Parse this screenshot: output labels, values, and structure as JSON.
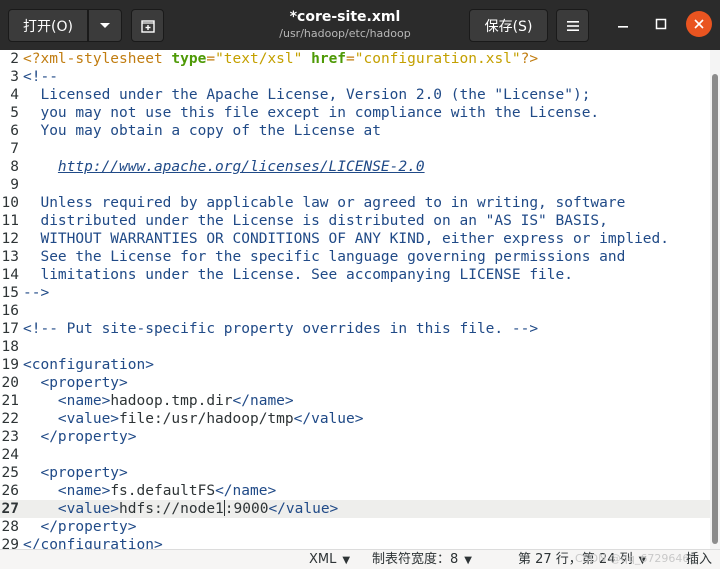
{
  "header": {
    "open_label": "打开(O)",
    "title": "*core-site.xml",
    "path": "/usr/hadoop/etc/hadoop",
    "save_label": "保存(S)"
  },
  "editor": {
    "current_line": 27,
    "lines": [
      {
        "n": "2",
        "segs": [
          [
            "pi",
            "<?xml-stylesheet "
          ],
          [
            "attr",
            "type"
          ],
          [
            "pi",
            "="
          ],
          [
            "str",
            "\"text/xsl\""
          ],
          [
            "pi",
            " "
          ],
          [
            "attr",
            "href"
          ],
          [
            "pi",
            "="
          ],
          [
            "str",
            "\"configuration.xsl\""
          ],
          [
            "pi",
            "?>"
          ]
        ]
      },
      {
        "n": "3",
        "segs": [
          [
            "comment",
            "<!--"
          ]
        ]
      },
      {
        "n": "4",
        "segs": [
          [
            "comment",
            "  Licensed under the Apache License, Version 2.0 (the \"License\");"
          ]
        ]
      },
      {
        "n": "5",
        "segs": [
          [
            "comment",
            "  you may not use this file except in compliance with the License."
          ]
        ]
      },
      {
        "n": "6",
        "segs": [
          [
            "comment",
            "  You may obtain a copy of the License at"
          ]
        ]
      },
      {
        "n": "7",
        "segs": []
      },
      {
        "n": "8",
        "segs": [
          [
            "comment",
            "    "
          ],
          [
            "link",
            "http://www.apache.org/licenses/LICENSE-2.0"
          ]
        ]
      },
      {
        "n": "9",
        "segs": []
      },
      {
        "n": "10",
        "segs": [
          [
            "comment",
            "  Unless required by applicable law or agreed to in writing, software"
          ]
        ]
      },
      {
        "n": "11",
        "segs": [
          [
            "comment",
            "  distributed under the License is distributed on an \"AS IS\" BASIS,"
          ]
        ]
      },
      {
        "n": "12",
        "segs": [
          [
            "comment",
            "  WITHOUT WARRANTIES OR CONDITIONS OF ANY KIND, either express or implied."
          ]
        ]
      },
      {
        "n": "13",
        "segs": [
          [
            "comment",
            "  See the License for the specific language governing permissions and"
          ]
        ]
      },
      {
        "n": "14",
        "segs": [
          [
            "comment",
            "  limitations under the License. See accompanying LICENSE file."
          ]
        ]
      },
      {
        "n": "15",
        "segs": [
          [
            "comment",
            "-->"
          ]
        ]
      },
      {
        "n": "16",
        "segs": []
      },
      {
        "n": "17",
        "segs": [
          [
            "comment",
            "<!-- Put site-specific property overrides in this file. -->"
          ]
        ]
      },
      {
        "n": "18",
        "segs": []
      },
      {
        "n": "19",
        "segs": [
          [
            "tag",
            "<configuration>"
          ]
        ]
      },
      {
        "n": "20",
        "segs": [
          [
            "text",
            "  "
          ],
          [
            "tag",
            "<property>"
          ]
        ]
      },
      {
        "n": "21",
        "segs": [
          [
            "text",
            "    "
          ],
          [
            "tag",
            "<name>"
          ],
          [
            "text",
            "hadoop.tmp.dir"
          ],
          [
            "tag",
            "</name>"
          ]
        ]
      },
      {
        "n": "22",
        "segs": [
          [
            "text",
            "    "
          ],
          [
            "tag",
            "<value>"
          ],
          [
            "text",
            "file:/usr/hadoop/tmp"
          ],
          [
            "tag",
            "</value>"
          ]
        ]
      },
      {
        "n": "23",
        "segs": [
          [
            "text",
            "  "
          ],
          [
            "tag",
            "</property>"
          ]
        ]
      },
      {
        "n": "24",
        "segs": []
      },
      {
        "n": "25",
        "segs": [
          [
            "text",
            "  "
          ],
          [
            "tag",
            "<property>"
          ]
        ]
      },
      {
        "n": "26",
        "segs": [
          [
            "text",
            "    "
          ],
          [
            "tag",
            "<name>"
          ],
          [
            "text",
            "fs.defaultFS"
          ],
          [
            "tag",
            "</name>"
          ]
        ]
      },
      {
        "n": "27",
        "segs": [
          [
            "text",
            "    "
          ],
          [
            "tag",
            "<value>"
          ],
          [
            "text",
            "hdfs://node1"
          ],
          [
            "cursor",
            ""
          ],
          [
            "text",
            ":9000"
          ],
          [
            "tag",
            "</value>"
          ]
        ]
      },
      {
        "n": "28",
        "segs": [
          [
            "text",
            "  "
          ],
          [
            "tag",
            "</property>"
          ]
        ]
      },
      {
        "n": "29",
        "segs": [
          [
            "tag",
            "</configuration>"
          ]
        ]
      }
    ]
  },
  "statusbar": {
    "language": "XML",
    "tab_width": "制表符宽度：8",
    "position": "第 27 行，第 24 列",
    "mode": "插入",
    "watermark": "CSDN @qq_67296465"
  }
}
